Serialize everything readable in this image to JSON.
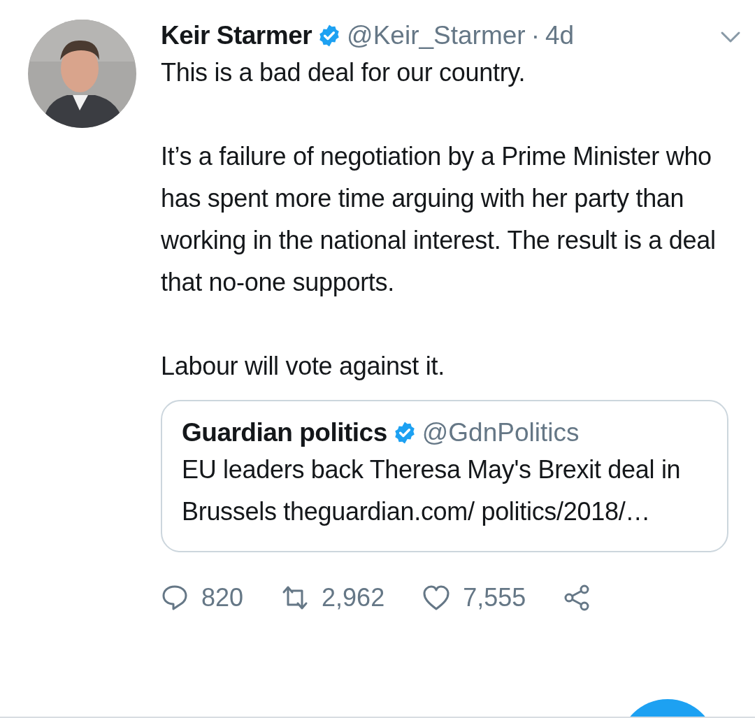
{
  "tweet": {
    "author": {
      "name": "Keir Starmer",
      "verified": true,
      "handle": "@Keir_Starmer",
      "separator": "·",
      "time": "4d"
    },
    "avatar": {
      "kind": "picture"
    },
    "paragraphs": [
      "This is a bad deal for our country.",
      "It’s a failure of negotiation by a Prime Minister who has spent more time arguing with her party than working in the national interest. The result is a deal that no-one supports.",
      "Labour will vote against it."
    ],
    "quoted": {
      "name": "Guardian politics",
      "verified": true,
      "handle": "@GdnPolitics",
      "text": "EU leaders back Theresa May's Brexit deal in Brussels theguardian.com/ politics/2018/…"
    },
    "actions": [
      {
        "kind": "reply",
        "count": "820"
      },
      {
        "kind": "retweet",
        "count": "2,962"
      },
      {
        "kind": "like",
        "count": "7,555"
      },
      {
        "kind": "share"
      }
    ]
  }
}
